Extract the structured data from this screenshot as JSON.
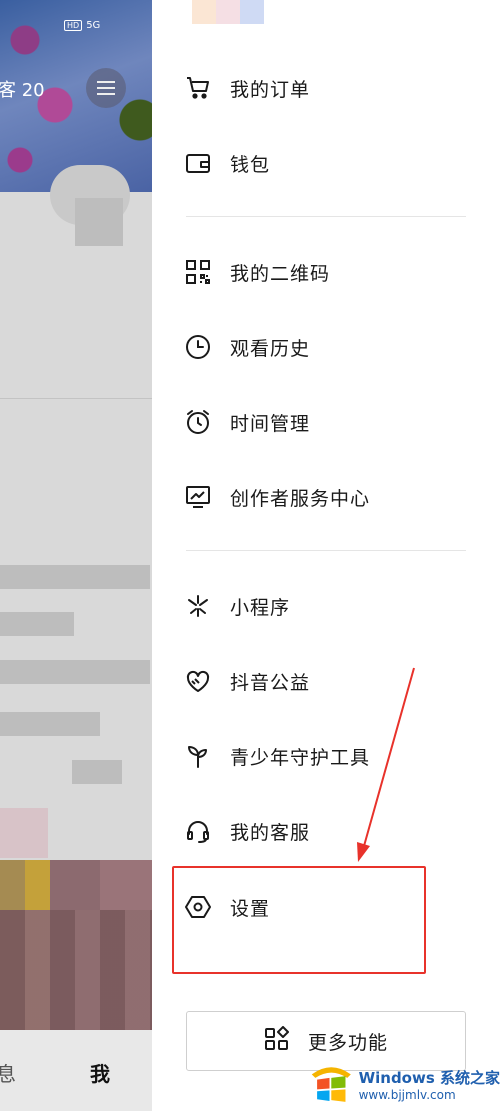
{
  "background": {
    "visitor_text": "客 20",
    "status_hd": "HD",
    "status_signal": "5G",
    "tab_left": "息",
    "tab_me": "我"
  },
  "drawer": {
    "section1": [
      {
        "label": "我的订单",
        "icon": "cart-icon"
      },
      {
        "label": "钱包",
        "icon": "wallet-icon"
      }
    ],
    "section2": [
      {
        "label": "我的二维码",
        "icon": "qr-code-icon"
      },
      {
        "label": "观看历史",
        "icon": "clock-icon"
      },
      {
        "label": "时间管理",
        "icon": "alarm-clock-icon"
      },
      {
        "label": "创作者服务中心",
        "icon": "chart-monitor-icon"
      }
    ],
    "section3": [
      {
        "label": "小程序",
        "icon": "mini-program-icon"
      },
      {
        "label": "抖音公益",
        "icon": "heart-hands-icon"
      },
      {
        "label": "青少年守护工具",
        "icon": "sprout-icon"
      },
      {
        "label": "我的客服",
        "icon": "headset-icon"
      },
      {
        "label": "设置",
        "icon": "hexagon-settings-icon"
      }
    ],
    "more_button": {
      "label": "更多功能",
      "icon": "grid-shapes-icon"
    }
  },
  "watermark": {
    "title": "Windows 系统之家",
    "url": "www.bjjmlv.com"
  },
  "colors": {
    "highlight": "#e8322b",
    "watermark": "#1f5fae"
  }
}
